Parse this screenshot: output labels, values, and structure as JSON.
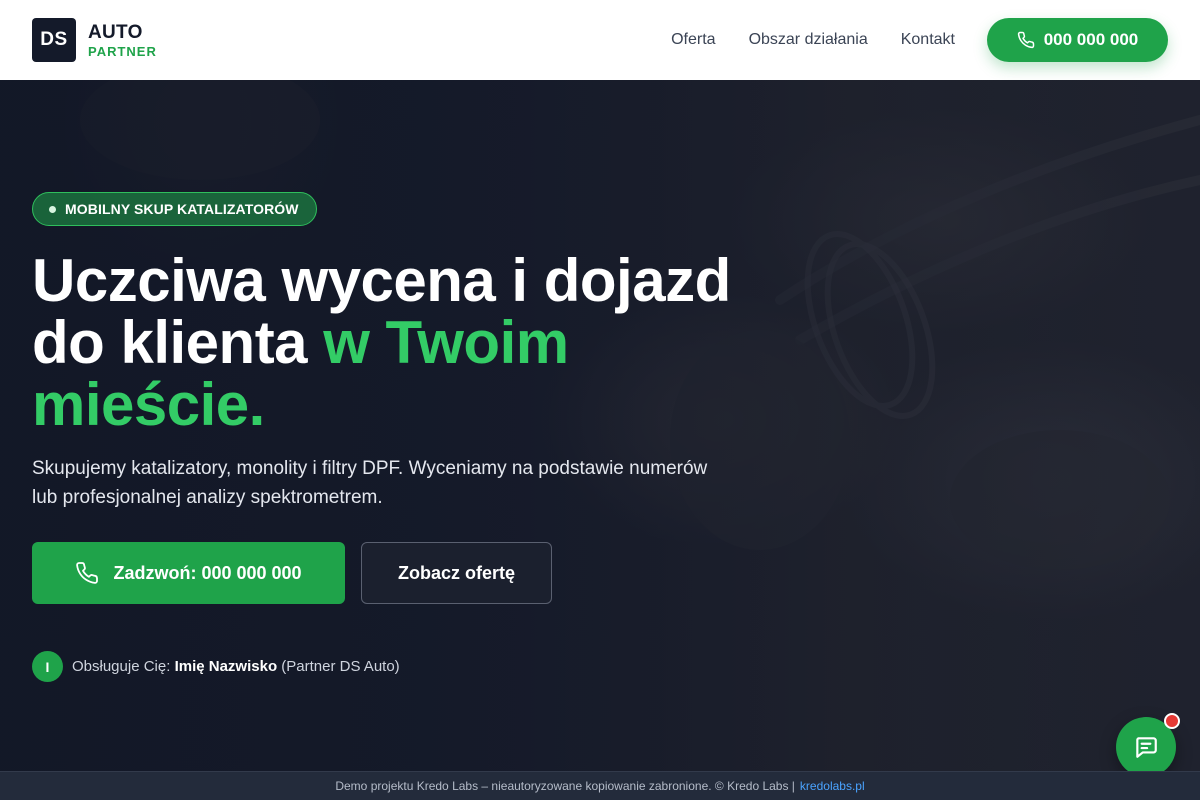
{
  "header": {
    "logo_badge": "DS",
    "logo_line1": "AUTO",
    "logo_line2": "PARTNER",
    "nav": [
      "Oferta",
      "Obszar działania",
      "Kontakt"
    ],
    "phone": "000 000 000"
  },
  "hero": {
    "badge": "MOBILNY SKUP KATALIZATORÓW",
    "headline_line1": "Uczciwa wycena i dojazd",
    "headline_line2_plain": "do klienta ",
    "headline_line2_accent": "w Twoim",
    "headline_line3_accent": "mieście.",
    "subtext": "Skupujemy katalizatory, monolity i filtry DPF. Wyceniamy na podstawie numerów lub profesjonalnej analizy spektrometrem.",
    "cta_call": "Zadzwoń: 000 000 000",
    "cta_offer": "Zobacz ofertę",
    "agent_initial": "I",
    "agent_prefix": "Obsługuje Cię:",
    "agent_name": "Imię Nazwisko",
    "agent_suffix": "(Partner DS Auto)"
  },
  "footer": {
    "text": "Demo projektu Kredo Labs – nieautoryzowane kopiowanie zabronione. © Kredo Labs |",
    "link": "kredolabs.pl"
  },
  "colors": {
    "accent_green": "#1fa34a",
    "headline_green": "#33cc66",
    "dark_navy": "#141a2a",
    "notification_red": "#e53935"
  },
  "icons": [
    "phone-icon",
    "chat-icon"
  ]
}
